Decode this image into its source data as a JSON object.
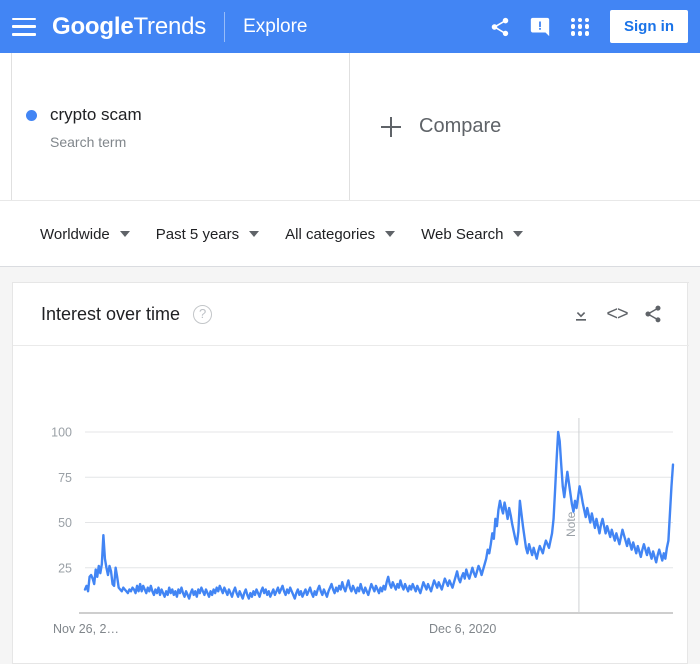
{
  "header": {
    "menu_icon": "hamburger-menu-icon",
    "brand_bold": "Google",
    "brand_light": "Trends",
    "nav_explore": "Explore",
    "share_icon": "share-icon",
    "feedback_icon": "feedback-icon",
    "apps_icon": "apps-grid-icon",
    "signin_label": "Sign in",
    "background_color": "#4285F4"
  },
  "query": {
    "term_label": "crypto scam",
    "term_type": "Search term",
    "series_color": "#4285F4",
    "compare_label": "Compare",
    "compare_icon": "plus-icon"
  },
  "filters": [
    {
      "label": "Worldwide",
      "caret": "chevron-down-icon"
    },
    {
      "label": "Past 5 years",
      "caret": "chevron-down-icon"
    },
    {
      "label": "All categories",
      "caret": "chevron-down-icon"
    },
    {
      "label": "Web Search",
      "caret": "chevron-down-icon"
    }
  ],
  "card": {
    "title": "Interest over time",
    "help_icon": "help-circle-icon",
    "help_glyph": "?",
    "download_icon": "download-icon",
    "embed_icon": "embed-code-icon",
    "embed_glyph": "<>",
    "share_icon": "share-icon"
  },
  "chart_data": {
    "type": "line",
    "title": "Interest over time",
    "xlabel": "",
    "ylabel": "",
    "ylim": [
      0,
      100
    ],
    "grid": true,
    "legend_position": "none",
    "y_ticks": [
      100,
      75,
      50,
      25
    ],
    "x_ticks": [
      {
        "label": "Nov 26, 2…",
        "position": 0.0
      },
      {
        "label": "Dec 6, 2020",
        "position": 0.585
      }
    ],
    "annotations": [
      {
        "label": "Note",
        "x_position": 0.84,
        "orientation": "vertical-line"
      }
    ],
    "series": [
      {
        "name": "crypto scam",
        "color": "#4285F4",
        "values": [
          13,
          15,
          12,
          20,
          21,
          19,
          16,
          24,
          20,
          26,
          22,
          27,
          43,
          30,
          25,
          21,
          26,
          23,
          16,
          15,
          25,
          20,
          14,
          13,
          12,
          14,
          13,
          12,
          11,
          13,
          12,
          14,
          13,
          11,
          15,
          12,
          16,
          12,
          15,
          13,
          11,
          14,
          12,
          15,
          12,
          10,
          13,
          11,
          14,
          10,
          13,
          11,
          9,
          12,
          10,
          14,
          11,
          13,
          10,
          12,
          9,
          13,
          11,
          14,
          11,
          9,
          12,
          10,
          8,
          11,
          13,
          10,
          12,
          9,
          13,
          11,
          14,
          12,
          10,
          13,
          11,
          9,
          12,
          10,
          13,
          11,
          14,
          12,
          15,
          13,
          11,
          14,
          12,
          10,
          13,
          11,
          9,
          12,
          14,
          11,
          9,
          12,
          10,
          8,
          11,
          13,
          10,
          8,
          11,
          9,
          12,
          10,
          13,
          11,
          9,
          12,
          14,
          11,
          13,
          10,
          12,
          9,
          11,
          13,
          10,
          12,
          14,
          11,
          13,
          15,
          12,
          10,
          13,
          11,
          14,
          12,
          10,
          8,
          11,
          13,
          10,
          12,
          9,
          11,
          13,
          10,
          12,
          14,
          11,
          9,
          12,
          10,
          13,
          15,
          12,
          10,
          13,
          11,
          9,
          12,
          14,
          16,
          13,
          11,
          14,
          12,
          15,
          13,
          17,
          14,
          12,
          15,
          18,
          14,
          12,
          15,
          13,
          11,
          14,
          12,
          16,
          13,
          11,
          14,
          12,
          10,
          13,
          16,
          14,
          12,
          15,
          13,
          11,
          14,
          12,
          15,
          13,
          17,
          20,
          16,
          14,
          17,
          15,
          13,
          16,
          14,
          18,
          15,
          13,
          16,
          14,
          12,
          15,
          13,
          16,
          14,
          12,
          15,
          13,
          11,
          14,
          17,
          15,
          13,
          16,
          14,
          12,
          15,
          18,
          16,
          14,
          17,
          15,
          13,
          16,
          19,
          17,
          15,
          18,
          16,
          14,
          17,
          20,
          23,
          19,
          17,
          20,
          22,
          19,
          24,
          21,
          19,
          22,
          25,
          22,
          20,
          23,
          26,
          24,
          21,
          24,
          27,
          30,
          35,
          33,
          38,
          44,
          41,
          52,
          48,
          57,
          62,
          58,
          55,
          61,
          57,
          52,
          58,
          54,
          49,
          45,
          41,
          38,
          45,
          62,
          55,
          48,
          42,
          36,
          33,
          38,
          35,
          32,
          36,
          33,
          30,
          34,
          37,
          35,
          33,
          37,
          40,
          38,
          36,
          40,
          44,
          52,
          68,
          85,
          100,
          95,
          82,
          70,
          64,
          71,
          78,
          72,
          66,
          60,
          56,
          62,
          58,
          64,
          70,
          66,
          61,
          57,
          53,
          58,
          54,
          50,
          55,
          51,
          47,
          52,
          48,
          44,
          49,
          52,
          48,
          44,
          48,
          45,
          42,
          46,
          43,
          40,
          44,
          41,
          38,
          42,
          46,
          43,
          40,
          37,
          41,
          38,
          35,
          39,
          36,
          33,
          37,
          34,
          31,
          35,
          38,
          35,
          32,
          36,
          33,
          30,
          34,
          31,
          28,
          32,
          35,
          32,
          29,
          33,
          30,
          36,
          40,
          55,
          70,
          82
        ]
      }
    ]
  }
}
